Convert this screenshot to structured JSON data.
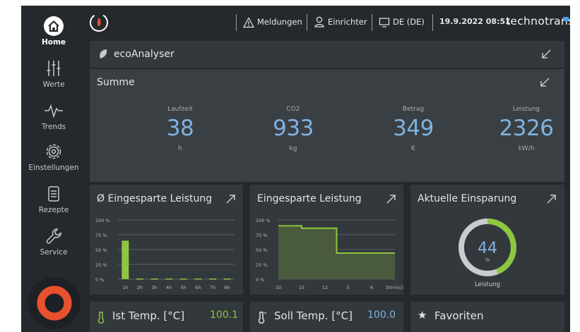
{
  "sidebar": {
    "items": [
      {
        "label": "Home",
        "icon": "home-icon",
        "active": true
      },
      {
        "label": "Werte",
        "icon": "sliders-icon"
      },
      {
        "label": "Trends",
        "icon": "trend-icon"
      },
      {
        "label": "Einstellungen",
        "icon": "gear-icon"
      },
      {
        "label": "Rezepte",
        "icon": "recipe-icon"
      },
      {
        "label": "Service",
        "icon": "wrench-icon"
      }
    ],
    "power_color": "#e8512e"
  },
  "topbar": {
    "messages": "Meldungen",
    "user": "Einrichter",
    "language": "DE (DE)",
    "datetime": "19.9.2022 08:51",
    "brand": "technotrans"
  },
  "eco": {
    "title": "ecoAnalyser",
    "summary_title": "Summe",
    "kpis": [
      {
        "label": "Laufzeit",
        "value": "38",
        "unit": "h"
      },
      {
        "label": "CO2",
        "value": "933",
        "unit": "kg"
      },
      {
        "label": "Betrag",
        "value": "349",
        "unit": "€"
      },
      {
        "label": "Leistung",
        "value": "2326",
        "unit": "kW/h"
      }
    ]
  },
  "chart_data": [
    {
      "type": "bar",
      "title": "Ø Eingesparte Leistung",
      "categories": [
        "1h",
        "2h",
        "3h",
        "4h",
        "5h",
        "6h",
        "7h",
        "8h"
      ],
      "values": [
        65,
        1,
        1,
        1,
        1,
        1,
        1,
        1
      ],
      "yticks": [
        "100 %",
        "75 %",
        "50 %",
        "25 %",
        "0 %"
      ],
      "ylim": [
        0,
        100
      ],
      "color": "#8dc63f"
    },
    {
      "type": "area",
      "title": "Eingesparte Leistung",
      "x": [
        "10",
        "15",
        "12",
        "5",
        "6",
        "30min/3"
      ],
      "values": [
        90,
        90,
        86,
        86,
        86,
        44,
        44,
        44,
        44,
        44,
        44
      ],
      "yticks": [
        "100 %",
        "75 %",
        "50 %",
        "25 %",
        "0 %"
      ],
      "ylim": [
        0,
        100
      ],
      "color": "#8dc63f"
    },
    {
      "type": "pie",
      "title": "Aktuelle Einsparung",
      "value": 44,
      "unit": "%",
      "label": "Leistung",
      "colors": {
        "fill": "#8dc63f",
        "track": "#c9cbcd",
        "text": "#7fb2e0"
      }
    }
  ],
  "bottom": {
    "ist": {
      "label": "Ist Temp. [°C]",
      "value": "100.1",
      "color": "#8dc63f"
    },
    "soll": {
      "label": "Soll Temp. [°C]",
      "value": "100.0",
      "color": "#7fb2e0"
    },
    "favorites": "Favoriten"
  }
}
